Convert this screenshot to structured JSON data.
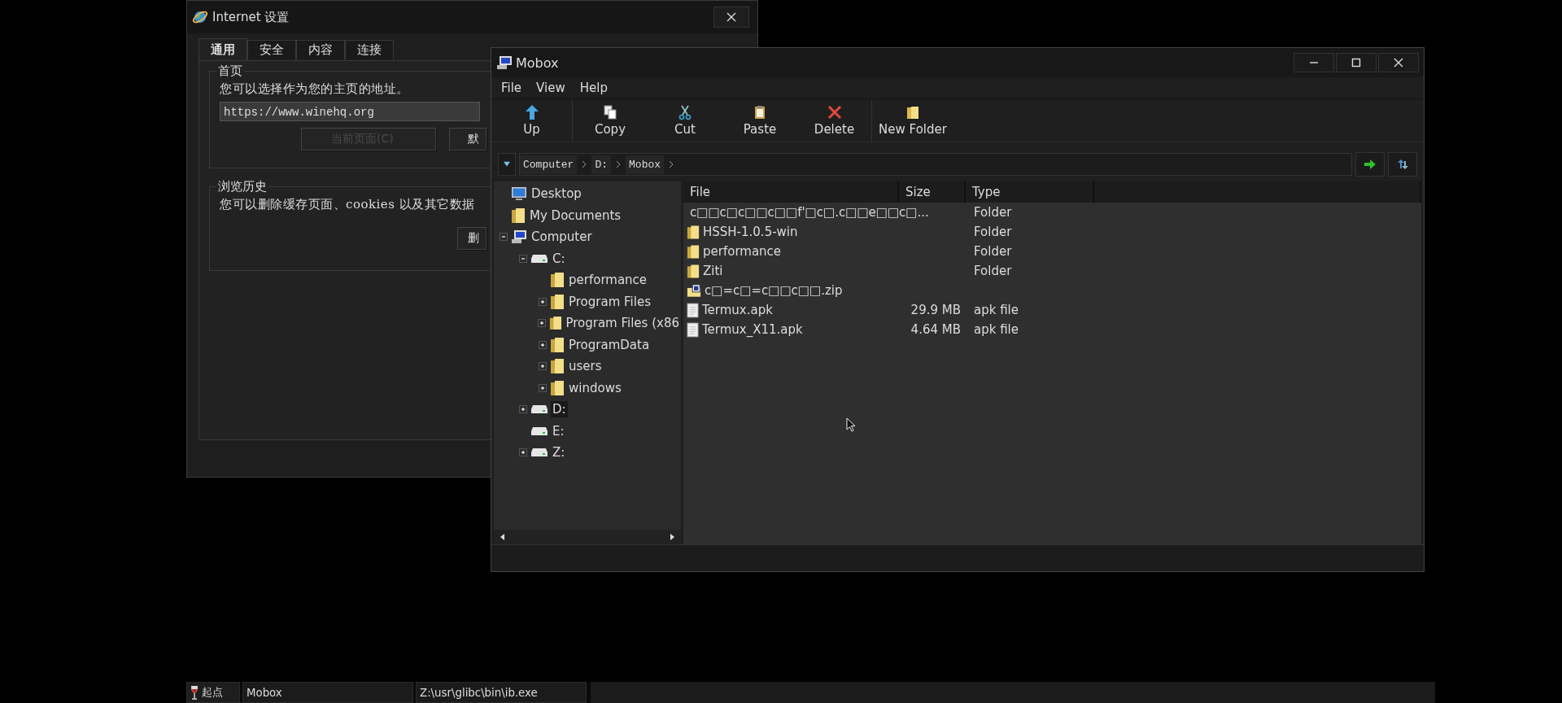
{
  "internet_window": {
    "title": "Internet 设置",
    "tabs": [
      {
        "label": "通用",
        "selected": true
      },
      {
        "label": "安全",
        "selected": false
      },
      {
        "label": "内容",
        "selected": false
      },
      {
        "label": "连接",
        "selected": false
      }
    ],
    "homepage_group": {
      "label": "首页",
      "text": "您可以选择作为您的主页的地址。",
      "url": "https://www.winehq.org",
      "buttons": [
        {
          "label": "当前页面(C)",
          "disabled": true
        },
        {
          "label": "默",
          "disabled": false
        }
      ]
    },
    "history_group": {
      "label": "浏览历史",
      "text": "您可以删除缓存页面、cookies 以及其它数据",
      "buttons": [
        {
          "label": "删",
          "disabled": false
        }
      ]
    }
  },
  "mobox": {
    "title": "Mobox",
    "menu": [
      "File",
      "View",
      "Help"
    ],
    "toolbar": [
      {
        "label": "Up",
        "kind": "up"
      },
      {
        "label": "Copy",
        "kind": "copy"
      },
      {
        "label": "Cut",
        "kind": "cut"
      },
      {
        "label": "Paste",
        "kind": "paste"
      },
      {
        "label": "Delete",
        "kind": "delete"
      },
      {
        "label": "New Folder",
        "kind": "newfolder"
      }
    ],
    "breadcrumb": [
      "Computer",
      "D:",
      "Mobox"
    ],
    "tree": [
      {
        "label": "Desktop",
        "kind": "desktop",
        "selected": false
      },
      {
        "label": "My Documents",
        "kind": "folder",
        "selected": false
      },
      {
        "label": "Computer",
        "kind": "computer",
        "expanded": true,
        "selected": false,
        "children": [
          {
            "label": "C:",
            "kind": "drive",
            "expanded": true,
            "selected": false,
            "children": [
              {
                "label": "performance",
                "kind": "folder",
                "selected": false
              },
              {
                "label": "Program Files",
                "kind": "folder",
                "expanded": false,
                "selected": false
              },
              {
                "label": "Program Files (x86",
                "kind": "folder",
                "expanded": false,
                "selected": false
              },
              {
                "label": "ProgramData",
                "kind": "folder",
                "expanded": false,
                "selected": false
              },
              {
                "label": "users",
                "kind": "folder",
                "expanded": false,
                "selected": false
              },
              {
                "label": "windows",
                "kind": "folder",
                "expanded": false,
                "selected": false
              }
            ]
          },
          {
            "label": "D:",
            "kind": "drive",
            "expanded": false,
            "selected": true
          },
          {
            "label": "E:",
            "kind": "drive",
            "selected": false
          },
          {
            "label": "Z:",
            "kind": "drive",
            "expanded": false,
            "selected": false
          }
        ]
      }
    ],
    "columns": [
      "File",
      "Size",
      "Type"
    ],
    "files": [
      {
        "name": "c□□c□c□□c□□f'□c□.c□□e□□c□...",
        "type": "Folder",
        "kind": "folder"
      },
      {
        "name": "HSSH-1.0.5-win",
        "type": "Folder",
        "kind": "folder"
      },
      {
        "name": "performance",
        "type": "Folder",
        "kind": "folder"
      },
      {
        "name": "Ziti",
        "type": "Folder",
        "kind": "folder"
      },
      {
        "name": "c□=c□=c□□c□□.zip",
        "kind": "zip"
      },
      {
        "name": "Termux.apk",
        "size": "29.9 MB",
        "type": "apk file",
        "kind": "file"
      },
      {
        "name": "Termux_X11.apk",
        "size": "4.64 MB",
        "type": "apk file",
        "kind": "file"
      }
    ]
  },
  "taskbar": {
    "start": "起点",
    "tasks": [
      "Mobox",
      "Z:\\usr\\glibc\\bin\\ib.exe"
    ]
  }
}
